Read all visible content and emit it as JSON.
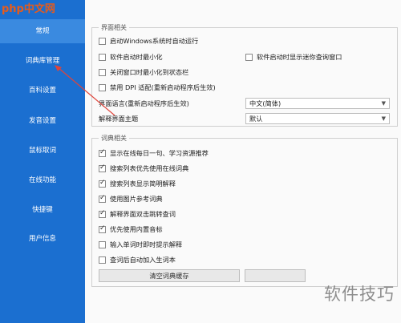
{
  "watermark": {
    "top_left": "php中文网",
    "bottom_right": "软件技巧"
  },
  "sidebar": {
    "items": [
      {
        "label": "常规",
        "active": true
      },
      {
        "label": "词典库管理",
        "active": false
      },
      {
        "label": "百科设置",
        "active": false
      },
      {
        "label": "发音设置",
        "active": false
      },
      {
        "label": "鼠标取词",
        "active": false
      },
      {
        "label": "在线功能",
        "active": false
      },
      {
        "label": "快捷键",
        "active": false
      },
      {
        "label": "用户信息",
        "active": false
      }
    ]
  },
  "interface_group": {
    "title": "界面相关",
    "checkboxes": [
      {
        "label": "启动Windows系统时自动运行",
        "checked": false
      },
      {
        "label": "软件启动时最小化",
        "checked": false
      },
      {
        "label": "软件启动时显示迷你查询窗口",
        "checked": false
      },
      {
        "label": "关闭窗口时最小化到状态栏",
        "checked": false
      },
      {
        "label": "禁用 DPI 适配(重新启动程序后生效)",
        "checked": false
      }
    ],
    "language_label": "界面语言(重新启动程序后生效)",
    "language_value": "中文(简体)",
    "theme_label": "解释界面主题",
    "theme_value": "默认"
  },
  "dict_group": {
    "title": "词典相关",
    "checkboxes": [
      {
        "label": "显示在线每日一句、学习资源推荐",
        "checked": true
      },
      {
        "label": "搜索列表优先使用在线词典",
        "checked": true
      },
      {
        "label": "搜索列表显示简明解释",
        "checked": true
      },
      {
        "label": "使用图片参考词典",
        "checked": true
      },
      {
        "label": "解释界面双击跳转查词",
        "checked": true
      },
      {
        "label": "优先使用内置音标",
        "checked": true
      },
      {
        "label": "输入单词时即时提示解释",
        "checked": false
      },
      {
        "label": "查词后自动加入生词本",
        "checked": false
      }
    ],
    "clear_cache_button": "清空词典缓存"
  }
}
